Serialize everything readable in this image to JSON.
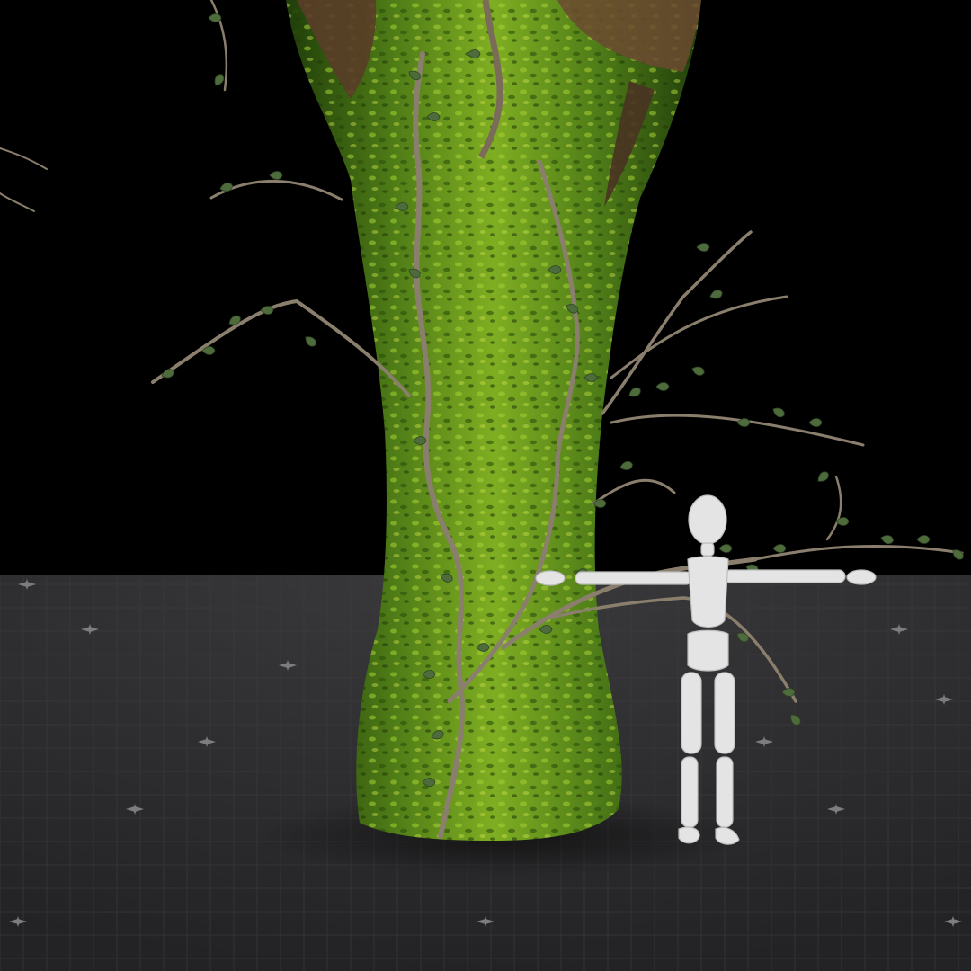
{
  "scene": {
    "background_color": "#000000",
    "floor_color": "#2c2c2e",
    "floor_grid_color": "#3a3a3c",
    "floor_marker_color": "#8a8a8a",
    "trunk_moss_colors": [
      "#2f5a12",
      "#5d8f1d",
      "#8fbf2a",
      "#b9d838"
    ],
    "bark_color": "#5a3d28",
    "vine_color": "#8b7d6a",
    "leaf_color": "#4c6b3a",
    "mannequin_color": "#e6e6e6",
    "mannequin_shadow": "#bdbdbd",
    "objects": [
      "tree-trunk",
      "ivy-vines",
      "wooden-mannequin",
      "grid-floor"
    ]
  }
}
